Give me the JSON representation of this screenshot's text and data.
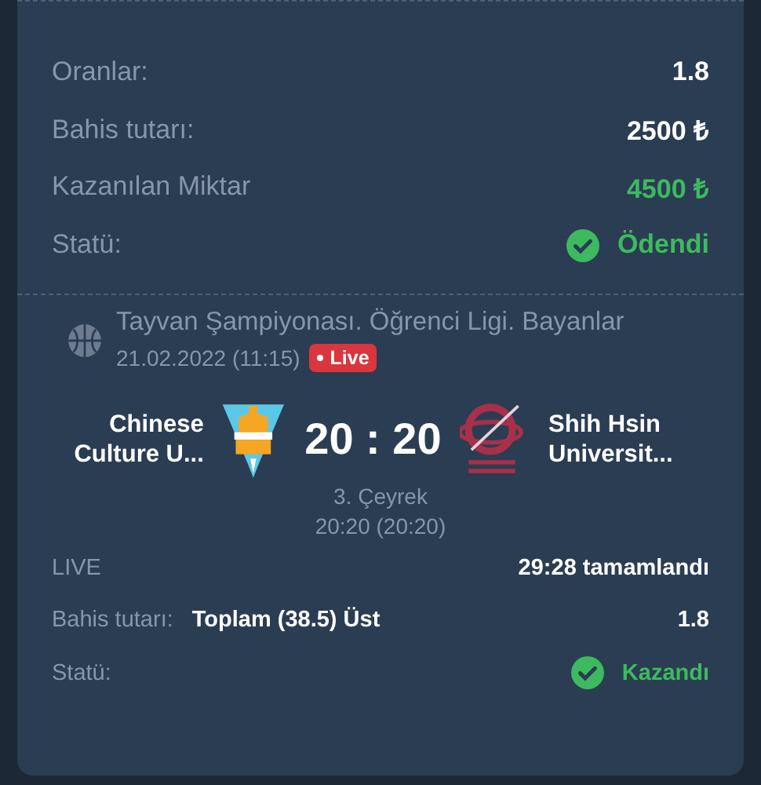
{
  "summary": [
    {
      "kind": "plain",
      "label": "Oranlar:",
      "value": "1.8"
    },
    {
      "kind": "plain",
      "label": "Bahis tutarı:",
      "value": "2500 ₺"
    },
    {
      "kind": "win",
      "label": "Kazanılan Miktar",
      "value": "4500 ₺"
    },
    {
      "kind": "status",
      "label": "Statü:",
      "value": "Ödendi"
    }
  ],
  "event": {
    "title": "Tayvan Şampiyonası. Öğrenci Ligi. Bayanlar",
    "date": "21.02.2022 (11:15)",
    "badge": "Live",
    "home": "Chinese Culture U...",
    "away": "Shih Hsin Universit...",
    "score": "20 : 20",
    "period": "3. Çeyrek",
    "period_score": "20:20 (20:20)"
  },
  "details": [
    {
      "kind": "plain",
      "label": "LIVE",
      "value": "29:28 tamamlandı"
    },
    {
      "kind": "bet",
      "label": "Bahis tutarı:",
      "pick": "Toplam (38.5) Üst",
      "value": "1.8"
    },
    {
      "kind": "status",
      "label": "Statü:",
      "value": "Kazandı"
    }
  ]
}
